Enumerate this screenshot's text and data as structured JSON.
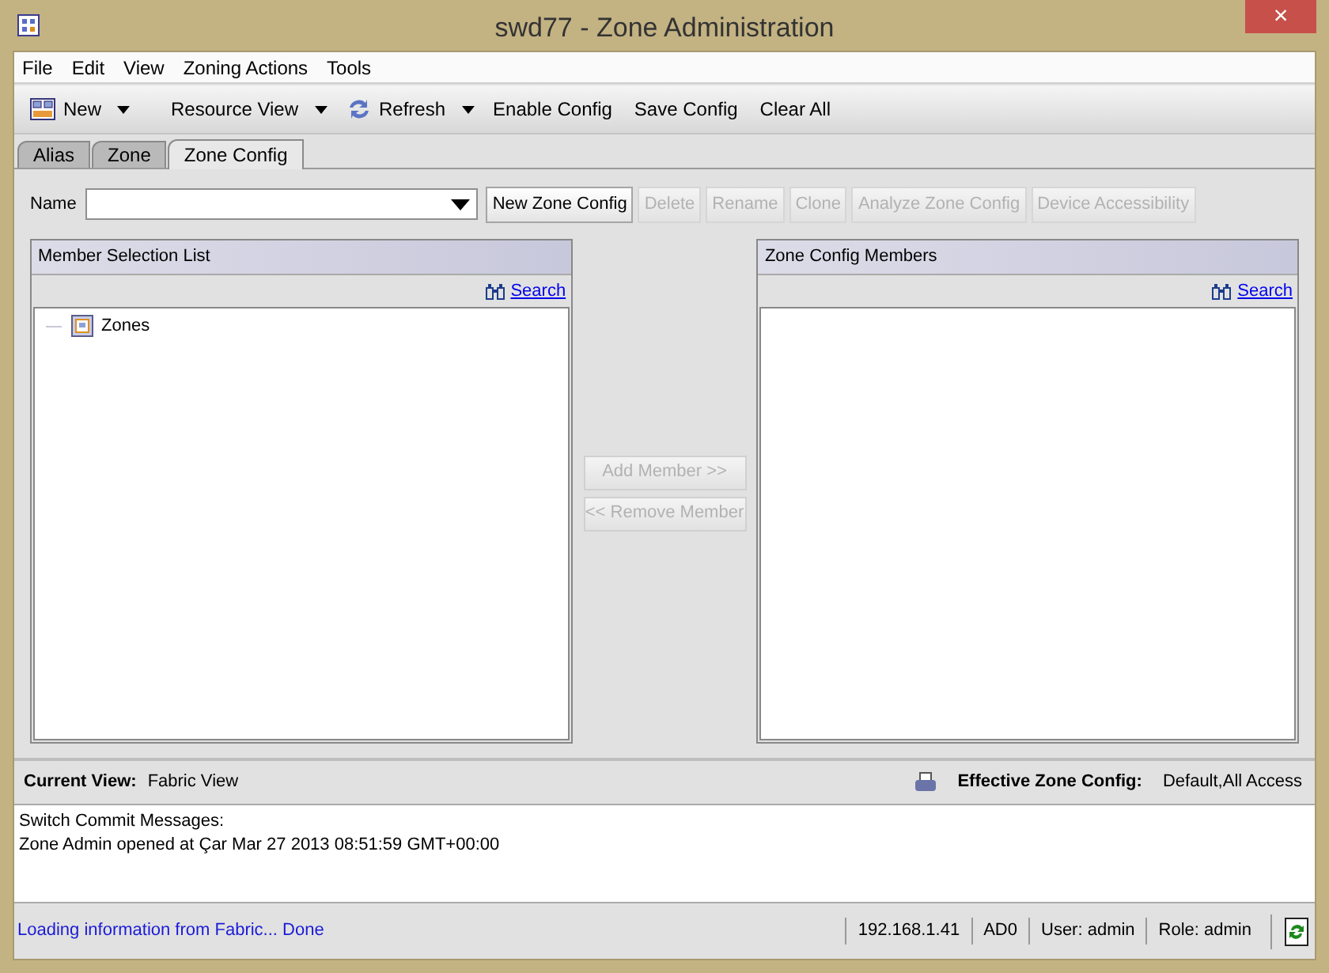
{
  "window": {
    "title": "swd77 - Zone Administration",
    "close": "×"
  },
  "menu": [
    "File",
    "Edit",
    "View",
    "Zoning Actions",
    "Tools"
  ],
  "toolbar": [
    {
      "label": "New",
      "kind": "grid",
      "dropdown": true
    },
    {
      "label": "Resource View",
      "kind": "plain",
      "dropdown": true
    },
    {
      "label": "Refresh",
      "kind": "refresh",
      "dropdown": true
    },
    {
      "label": "Enable Config",
      "kind": "plain",
      "dropdown": false
    },
    {
      "label": "Save Config",
      "kind": "plain",
      "dropdown": false
    },
    {
      "label": "Clear All",
      "kind": "plain",
      "dropdown": false
    }
  ],
  "tabs": [
    {
      "label": "Alias",
      "selected": false
    },
    {
      "label": "Zone",
      "selected": false
    },
    {
      "label": "Zone Config",
      "selected": true
    }
  ],
  "name_field": {
    "label": "Name"
  },
  "actions": [
    {
      "label": "New Zone Config",
      "disabled": false
    },
    {
      "label": "Delete",
      "disabled": true
    },
    {
      "label": "Rename",
      "disabled": true
    },
    {
      "label": "Clone",
      "disabled": true
    },
    {
      "label": "Analyze Zone Config",
      "disabled": true
    },
    {
      "label": "Device Accessibility",
      "disabled": true
    }
  ],
  "left_panel": {
    "title": "Member Selection List",
    "search": "Search",
    "tree": [
      {
        "label": "Zones"
      }
    ]
  },
  "middle_buttons": [
    {
      "label": "Add Member >>",
      "disabled": true
    },
    {
      "label": "<< Remove Member",
      "disabled": true
    }
  ],
  "right_panel": {
    "title": "Zone Config Members",
    "search": "Search"
  },
  "view_bar": {
    "current_view_label": "Current View:",
    "current_view": "Fabric View",
    "effective_label": "Effective Zone Config:",
    "effective": "Default,All Access"
  },
  "messages": [
    "Switch Commit Messages:",
    "Zone Admin opened at Çar Mar 27 2013 08:51:59 GMT+00:00"
  ],
  "status_bar": {
    "message": "Loading information from Fabric... Done",
    "fields": [
      "192.168.1.41",
      "AD0",
      "User: admin",
      "Role: admin"
    ]
  }
}
